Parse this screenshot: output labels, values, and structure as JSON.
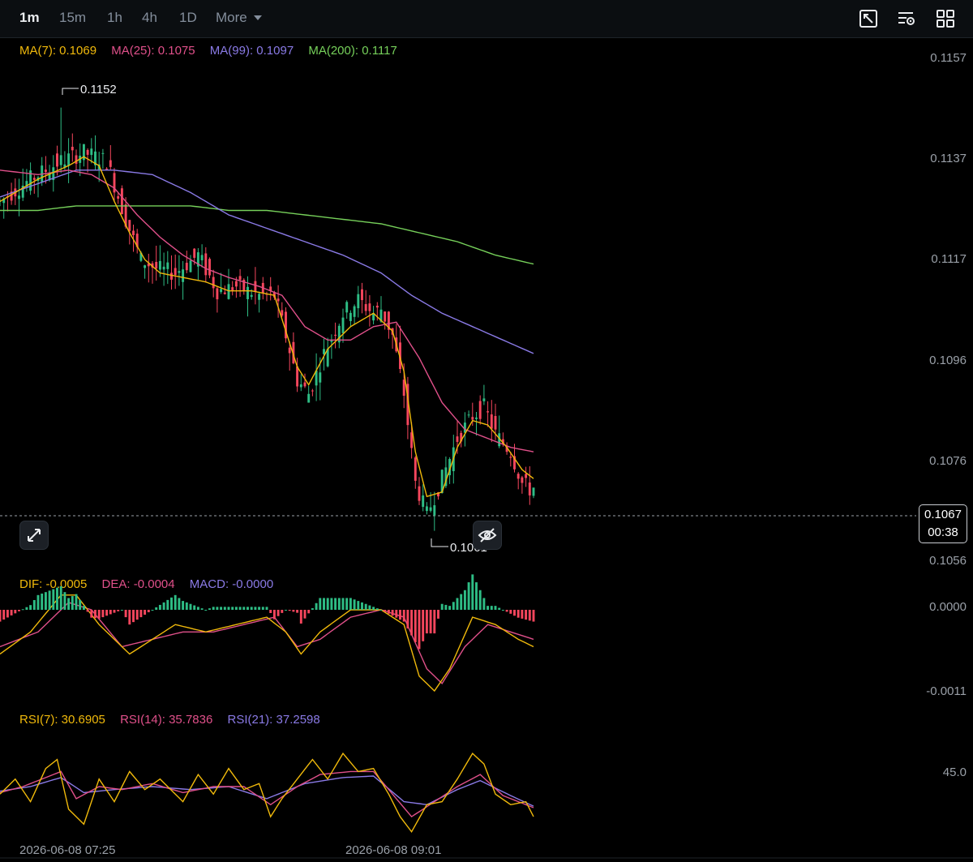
{
  "toolbar": {
    "timeframes": [
      "1m",
      "15m",
      "1h",
      "4h",
      "1D"
    ],
    "active_timeframe": "1m",
    "more_label": "More",
    "icons": [
      "chart-settings-icon",
      "indicator-settings-icon",
      "layout-grid-icon"
    ]
  },
  "legends": {
    "ma": {
      "ma7": "MA(7): 0.1069",
      "ma25": "MA(25): 0.1075",
      "ma99": "MA(99): 0.1097",
      "ma200": "MA(200): 0.1117"
    },
    "macd": {
      "dif": "DIF: -0.0005",
      "dea": "DEA: -0.0004",
      "macd": "MACD: -0.0000"
    },
    "rsi": {
      "rsi7": "RSI(7): 30.6905",
      "rsi14": "RSI(14): 35.7836",
      "rsi21": "RSI(21): 37.2598"
    }
  },
  "price_axis": [
    "0.1157",
    "0.1137",
    "0.1117",
    "0.1096",
    "0.1076",
    "0.1056"
  ],
  "macd_axis": [
    "0.0000",
    "-0.0011"
  ],
  "rsi_axis": [
    "45.0"
  ],
  "current_price": {
    "price": "0.1067",
    "countdown": "00:38"
  },
  "annotations": {
    "high": "0.1152",
    "low": "0.1061"
  },
  "dates": [
    "2026-06-08 07:25",
    "2026-06-08 09:01"
  ],
  "colors": {
    "up": "#2ebd85",
    "down": "#f6465d",
    "ma7": "#f0b90b",
    "ma25": "#e0508a",
    "ma99": "#8a7ae6",
    "ma200": "#76d05a",
    "dif": "#f0b90b",
    "dea": "#e0508a",
    "rsi7": "#f0b90b",
    "rsi14": "#e0508a",
    "rsi21": "#8a7ae6"
  },
  "chart_data": {
    "type": "candlestick",
    "ylim": [
      0.105,
      0.1163
    ],
    "high": 0.1152,
    "low": 0.1061,
    "last": 0.1067,
    "close_path": [
      [
        0,
        0.1131
      ],
      [
        8,
        0.1136
      ],
      [
        16,
        0.114
      ],
      [
        22,
        0.1142
      ],
      [
        28,
        0.114
      ],
      [
        33,
        0.1127
      ],
      [
        37,
        0.1118
      ],
      [
        41,
        0.1116
      ],
      [
        46,
        0.1115
      ],
      [
        52,
        0.1119
      ],
      [
        57,
        0.1111
      ],
      [
        62,
        0.1112
      ],
      [
        68,
        0.111
      ],
      [
        72,
        0.111
      ],
      [
        75,
        0.1101
      ],
      [
        78,
        0.1091
      ],
      [
        81,
        0.1088
      ],
      [
        85,
        0.1097
      ],
      [
        90,
        0.1106
      ],
      [
        94,
        0.1109
      ],
      [
        98,
        0.1106
      ],
      [
        100,
        0.1107
      ],
      [
        103,
        0.1101
      ],
      [
        106,
        0.1088
      ],
      [
        109,
        0.1068
      ],
      [
        112,
        0.1061
      ],
      [
        116,
        0.1069
      ],
      [
        120,
        0.1078
      ],
      [
        124,
        0.1083
      ],
      [
        127,
        0.1085
      ],
      [
        130,
        0.1079
      ],
      [
        134,
        0.1075
      ],
      [
        137,
        0.1068
      ],
      [
        140,
        0.1066
      ]
    ],
    "ma7": [
      [
        0,
        0.1131
      ],
      [
        10,
        0.1136
      ],
      [
        18,
        0.1139
      ],
      [
        22,
        0.1141
      ],
      [
        26,
        0.1139
      ],
      [
        30,
        0.1131
      ],
      [
        34,
        0.1124
      ],
      [
        38,
        0.1118
      ],
      [
        42,
        0.1115
      ],
      [
        48,
        0.1114
      ],
      [
        54,
        0.1113
      ],
      [
        60,
        0.1111
      ],
      [
        66,
        0.1111
      ],
      [
        72,
        0.111
      ],
      [
        75,
        0.1102
      ],
      [
        78,
        0.1094
      ],
      [
        81,
        0.109
      ],
      [
        86,
        0.1098
      ],
      [
        92,
        0.1103
      ],
      [
        98,
        0.1106
      ],
      [
        103,
        0.1102
      ],
      [
        106,
        0.1093
      ],
      [
        109,
        0.1075
      ],
      [
        112,
        0.1065
      ],
      [
        116,
        0.1066
      ],
      [
        120,
        0.1076
      ],
      [
        124,
        0.1082
      ],
      [
        128,
        0.1081
      ],
      [
        133,
        0.1076
      ],
      [
        137,
        0.1071
      ],
      [
        140,
        0.1069
      ]
    ],
    "ma25": [
      [
        0,
        0.1138
      ],
      [
        10,
        0.1137
      ],
      [
        18,
        0.1138
      ],
      [
        24,
        0.1137
      ],
      [
        30,
        0.1134
      ],
      [
        36,
        0.1128
      ],
      [
        42,
        0.1123
      ],
      [
        48,
        0.1119
      ],
      [
        54,
        0.1116
      ],
      [
        60,
        0.1114
      ],
      [
        68,
        0.1112
      ],
      [
        74,
        0.111
      ],
      [
        80,
        0.1103
      ],
      [
        86,
        0.11
      ],
      [
        92,
        0.11
      ],
      [
        98,
        0.1103
      ],
      [
        104,
        0.1104
      ],
      [
        110,
        0.1096
      ],
      [
        116,
        0.1086
      ],
      [
        122,
        0.108
      ],
      [
        128,
        0.1078
      ],
      [
        134,
        0.1076
      ],
      [
        140,
        0.1075
      ]
    ],
    "ma99": [
      [
        0,
        0.1132
      ],
      [
        10,
        0.1135
      ],
      [
        20,
        0.1138
      ],
      [
        30,
        0.1138
      ],
      [
        40,
        0.1137
      ],
      [
        50,
        0.1133
      ],
      [
        60,
        0.1128
      ],
      [
        70,
        0.1125
      ],
      [
        80,
        0.1122
      ],
      [
        90,
        0.1119
      ],
      [
        100,
        0.1115
      ],
      [
        108,
        0.111
      ],
      [
        116,
        0.1106
      ],
      [
        124,
        0.1103
      ],
      [
        132,
        0.11
      ],
      [
        140,
        0.1097
      ]
    ],
    "ma200": [
      [
        0,
        0.1129
      ],
      [
        10,
        0.1129
      ],
      [
        20,
        0.113
      ],
      [
        30,
        0.113
      ],
      [
        40,
        0.113
      ],
      [
        50,
        0.113
      ],
      [
        60,
        0.1129
      ],
      [
        70,
        0.1129
      ],
      [
        80,
        0.1128
      ],
      [
        90,
        0.1127
      ],
      [
        100,
        0.1126
      ],
      [
        110,
        0.1124
      ],
      [
        120,
        0.1122
      ],
      [
        130,
        0.1119
      ],
      [
        140,
        0.1117
      ]
    ],
    "macd_ylim": [
      -0.0013,
      0.0004
    ],
    "dif": [
      [
        0,
        -0.0006
      ],
      [
        8,
        -0.0003
      ],
      [
        16,
        0.0002
      ],
      [
        20,
        0.0002
      ],
      [
        26,
        -0.0002
      ],
      [
        34,
        -0.0006
      ],
      [
        40,
        -0.0004
      ],
      [
        46,
        -0.0002
      ],
      [
        54,
        -0.0003
      ],
      [
        62,
        -0.0002
      ],
      [
        70,
        -0.0001
      ],
      [
        75,
        -0.0003
      ],
      [
        79,
        -0.0006
      ],
      [
        84,
        -0.0003
      ],
      [
        92,
        0.0
      ],
      [
        100,
        0.0
      ],
      [
        106,
        -0.0002
      ],
      [
        110,
        -0.0009
      ],
      [
        114,
        -0.0011
      ],
      [
        118,
        -0.0008
      ],
      [
        124,
        -0.0001
      ],
      [
        130,
        -0.0002
      ],
      [
        136,
        -0.0004
      ],
      [
        140,
        -0.0005
      ]
    ],
    "dea": [
      [
        0,
        -0.0005
      ],
      [
        10,
        -0.0003
      ],
      [
        18,
        0.0001
      ],
      [
        24,
        0.0
      ],
      [
        32,
        -0.0005
      ],
      [
        40,
        -0.0004
      ],
      [
        48,
        -0.0003
      ],
      [
        56,
        -0.0003
      ],
      [
        64,
        -0.0002
      ],
      [
        72,
        -0.0001
      ],
      [
        78,
        -0.0005
      ],
      [
        84,
        -0.0004
      ],
      [
        92,
        -0.0001
      ],
      [
        100,
        0.0
      ],
      [
        106,
        -0.0001
      ],
      [
        112,
        -0.0008
      ],
      [
        116,
        -0.001
      ],
      [
        122,
        -0.0005
      ],
      [
        128,
        -0.0002
      ],
      [
        134,
        -0.0003
      ],
      [
        140,
        -0.0004
      ]
    ],
    "rsi_ylim": [
      15,
      85
    ],
    "rsi7": [
      [
        0,
        45
      ],
      [
        4,
        55
      ],
      [
        8,
        40
      ],
      [
        12,
        62
      ],
      [
        15,
        68
      ],
      [
        18,
        35
      ],
      [
        22,
        25
      ],
      [
        26,
        55
      ],
      [
        30,
        40
      ],
      [
        34,
        60
      ],
      [
        38,
        48
      ],
      [
        42,
        55
      ],
      [
        48,
        40
      ],
      [
        52,
        58
      ],
      [
        56,
        45
      ],
      [
        60,
        62
      ],
      [
        64,
        48
      ],
      [
        68,
        52
      ],
      [
        71,
        30
      ],
      [
        74,
        42
      ],
      [
        78,
        55
      ],
      [
        82,
        68
      ],
      [
        86,
        55
      ],
      [
        90,
        72
      ],
      [
        94,
        60
      ],
      [
        98,
        62
      ],
      [
        102,
        45
      ],
      [
        105,
        30
      ],
      [
        108,
        20
      ],
      [
        112,
        38
      ],
      [
        116,
        40
      ],
      [
        120,
        55
      ],
      [
        124,
        72
      ],
      [
        127,
        65
      ],
      [
        130,
        45
      ],
      [
        134,
        38
      ],
      [
        138,
        40
      ],
      [
        140,
        30
      ]
    ],
    "rsi14": [
      [
        0,
        46
      ],
      [
        6,
        50
      ],
      [
        12,
        56
      ],
      [
        16,
        60
      ],
      [
        20,
        42
      ],
      [
        26,
        50
      ],
      [
        32,
        48
      ],
      [
        40,
        52
      ],
      [
        48,
        46
      ],
      [
        56,
        50
      ],
      [
        64,
        50
      ],
      [
        71,
        38
      ],
      [
        78,
        50
      ],
      [
        84,
        58
      ],
      [
        92,
        60
      ],
      [
        98,
        60
      ],
      [
        104,
        42
      ],
      [
        108,
        30
      ],
      [
        114,
        40
      ],
      [
        120,
        50
      ],
      [
        126,
        58
      ],
      [
        132,
        44
      ],
      [
        140,
        36
      ]
    ],
    "rsi21": [
      [
        0,
        47
      ],
      [
        8,
        50
      ],
      [
        16,
        56
      ],
      [
        22,
        46
      ],
      [
        30,
        48
      ],
      [
        40,
        50
      ],
      [
        50,
        48
      ],
      [
        60,
        50
      ],
      [
        70,
        42
      ],
      [
        80,
        52
      ],
      [
        90,
        56
      ],
      [
        98,
        57
      ],
      [
        106,
        40
      ],
      [
        112,
        38
      ],
      [
        120,
        48
      ],
      [
        126,
        54
      ],
      [
        134,
        44
      ],
      [
        140,
        37
      ]
    ]
  }
}
